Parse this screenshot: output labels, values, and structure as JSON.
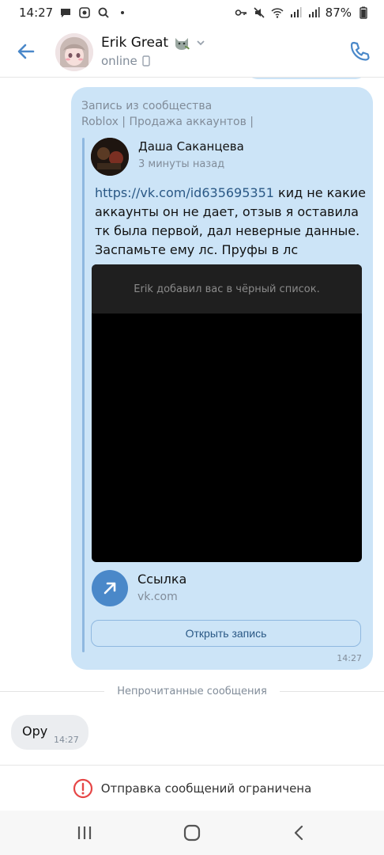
{
  "status": {
    "time": "14:27",
    "battery": "87%"
  },
  "header": {
    "name": "Erik Great",
    "presence": "online"
  },
  "post": {
    "label_line1": "Запись из сообщества",
    "label_line2": "Roblox | Продажа аккаунтов |",
    "author": "Даша Саканцева",
    "time": "3 минуты назад",
    "link_text": "https://vk.com/id635695351",
    "text_rest": " кид не какие аккаунты он  не дает, отзыв я оставила тк была первой, дал неверные данные. Заспамьте ему лс. Пруфы в лс",
    "media_caption": "Erik добавил вас в чёрный список.",
    "link_card_title": "Ссылка",
    "link_card_domain": "vk.com",
    "open_button": "Открыть запись",
    "bubble_time": "14:27"
  },
  "unread_label": "Непрочитанные сообщения",
  "incoming": {
    "text": "Ору",
    "time": "14:27"
  },
  "restriction": "Отправка сообщений ограничена",
  "colors": {
    "accent": "#4a88c9",
    "bubble_out": "#cce4f7",
    "bubble_in": "#ebedf0",
    "alert": "#e64646"
  },
  "icons": [
    "back-arrow-icon",
    "phone-icon",
    "arrow-up-right-icon",
    "alert-circle-icon",
    "recent-apps-icon",
    "home-icon",
    "back-nav-icon"
  ]
}
